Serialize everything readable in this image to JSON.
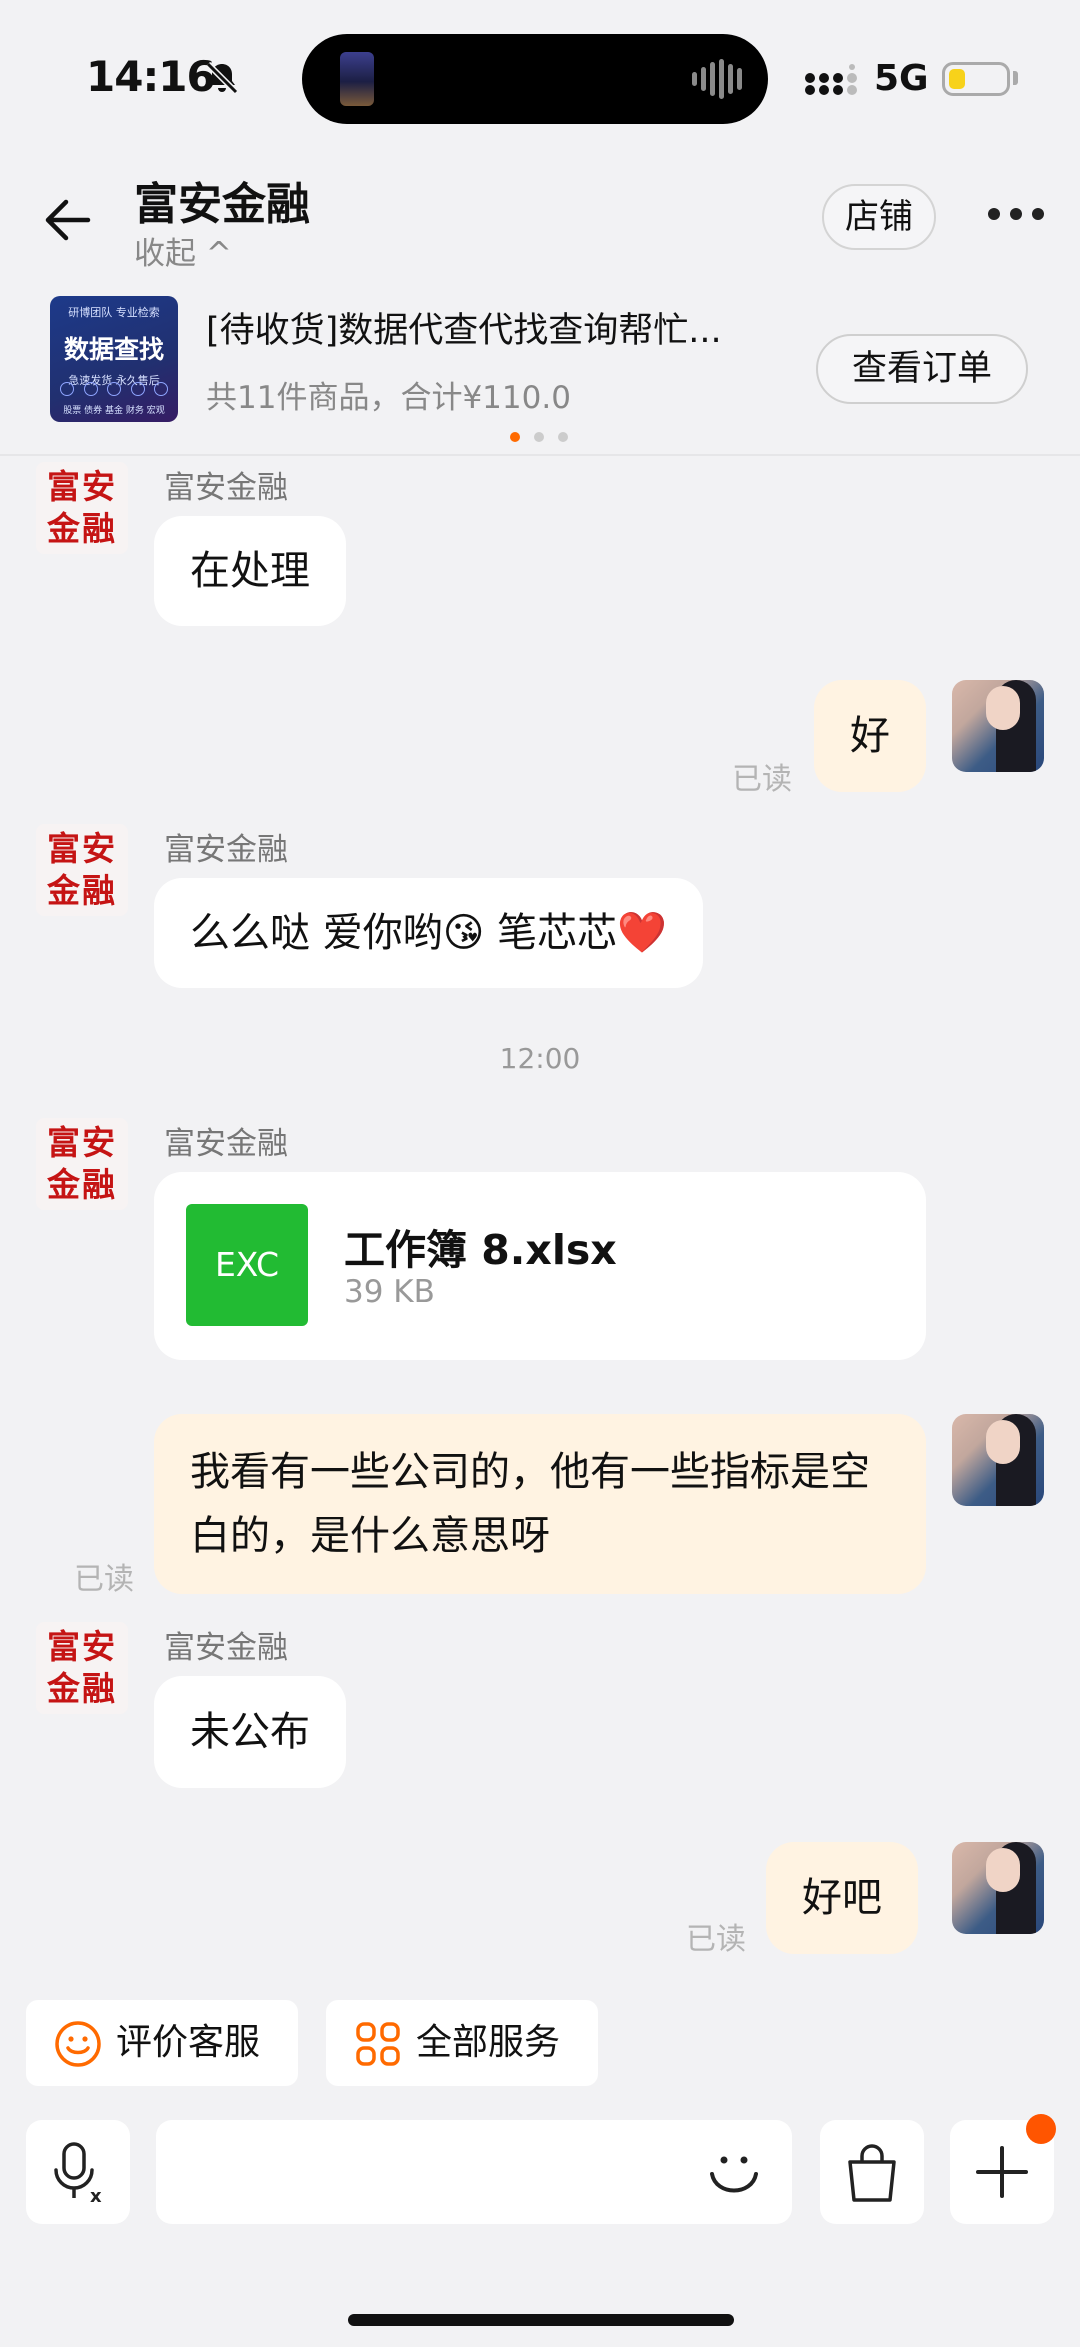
{
  "status_bar": {
    "time": "14:16",
    "network": "5G",
    "battery_color": "#f7d21a"
  },
  "header": {
    "title": "富安金融",
    "collapse_label": "收起 ^",
    "store_button": "店铺"
  },
  "order": {
    "thumb_top": "研博团队 专业检索",
    "thumb_main": "数据查找",
    "thumb_sub": "急速发货  永久售后",
    "thumb_foot": "股票 债券 基金 财务 宏观",
    "title": "[待收货]数据代查代找查询帮忙...",
    "summary": "共11件商品，合计¥110.0",
    "view_button": "查看订单"
  },
  "shop_avatar_text": "富安金融",
  "messages": {
    "m1_sender": "富安金融",
    "m1_text": "在处理",
    "m2_text": "好",
    "m2_status": "已读",
    "m3_sender": "富安金融",
    "m3_text": "么么哒 爱你哟😘  笔芯芯❤️",
    "time_divider": "12:00",
    "m4_sender": "富安金融",
    "m4_file_icon": "EXC",
    "m4_file_name": "工作簿 8.xlsx",
    "m4_file_size": "39 KB",
    "m5_text": "我看有一些公司的，他有一些指标是空白的，是什么意思呀",
    "m5_status": "已读",
    "m6_sender": "富安金融",
    "m6_text": "未公布",
    "m7_text": "好吧",
    "m7_status": "已读"
  },
  "quick_actions": {
    "rate_service": "评价客服",
    "all_services": "全部服务",
    "accent_color": "#ff6a00"
  },
  "input_bar": {
    "voice_icon": "microphone-translate-icon",
    "emoji_icon": "smile-icon",
    "bag_icon": "shopping-bag-icon",
    "plus_icon": "plus-icon",
    "badge_color": "#ff5500"
  }
}
